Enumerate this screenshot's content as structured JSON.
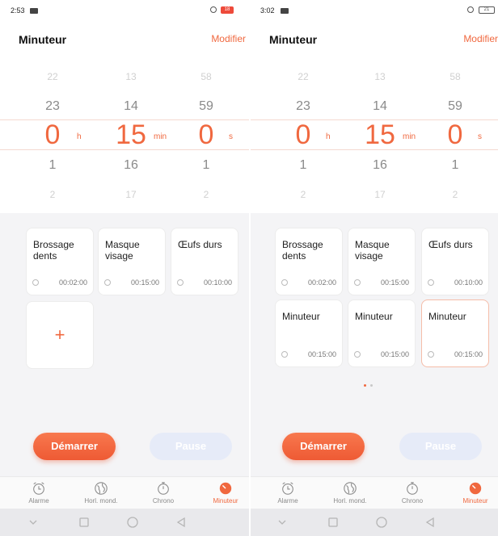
{
  "screens": [
    {
      "status": {
        "time": "2:53",
        "battery": "18"
      },
      "header": {
        "title": "Minuteur",
        "edit_label": "Modifier"
      },
      "picker": {
        "hours": [
          "22",
          "23",
          "0",
          "1",
          "2"
        ],
        "minutes": [
          "13",
          "14",
          "15",
          "16",
          "17"
        ],
        "seconds": [
          "58",
          "59",
          "0",
          "1",
          "2"
        ],
        "unit_h": "h",
        "unit_min": "min",
        "unit_s": "s"
      },
      "presets": [
        {
          "name": "Brossage dents",
          "time": "00:02:00"
        },
        {
          "name": "Masque visage",
          "time": "00:15:00"
        },
        {
          "name": "Œufs durs",
          "time": "00:10:00"
        }
      ],
      "add_label": "+",
      "buttons": {
        "start": "Démarrer",
        "pause": "Pause"
      },
      "tabs": [
        {
          "label": "Alarme",
          "icon": "alarm-clock-icon"
        },
        {
          "label": "Horl. mond.",
          "icon": "globe-icon"
        },
        {
          "label": "Chrono",
          "icon": "stopwatch-icon"
        },
        {
          "label": "Minuteur",
          "icon": "timer-icon",
          "active": true
        }
      ]
    },
    {
      "status": {
        "time": "3:02",
        "battery": "21"
      },
      "header": {
        "title": "Minuteur",
        "edit_label": "Modifier"
      },
      "picker": {
        "hours": [
          "22",
          "23",
          "0",
          "1",
          "2"
        ],
        "minutes": [
          "13",
          "14",
          "15",
          "16",
          "17"
        ],
        "seconds": [
          "58",
          "59",
          "0",
          "1",
          "2"
        ],
        "unit_h": "h",
        "unit_min": "min",
        "unit_s": "s"
      },
      "presets": [
        {
          "name": "Brossage dents",
          "time": "00:02:00"
        },
        {
          "name": "Masque visage",
          "time": "00:15:00"
        },
        {
          "name": "Œufs durs",
          "time": "00:10:00"
        },
        {
          "name": "Minuteur",
          "time": "00:15:00"
        },
        {
          "name": "Minuteur",
          "time": "00:15:00"
        },
        {
          "name": "Minuteur",
          "time": "00:15:00"
        }
      ],
      "buttons": {
        "start": "Démarrer",
        "pause": "Pause"
      },
      "tabs": [
        {
          "label": "Alarme",
          "icon": "alarm-clock-icon"
        },
        {
          "label": "Horl. mond.",
          "icon": "globe-icon"
        },
        {
          "label": "Chrono",
          "icon": "stopwatch-icon"
        },
        {
          "label": "Minuteur",
          "icon": "timer-icon",
          "active": true
        }
      ]
    }
  ],
  "colors": {
    "accent": "#f0683f",
    "pause_bg": "#e6ebf8",
    "background": "#f4f4f6"
  }
}
